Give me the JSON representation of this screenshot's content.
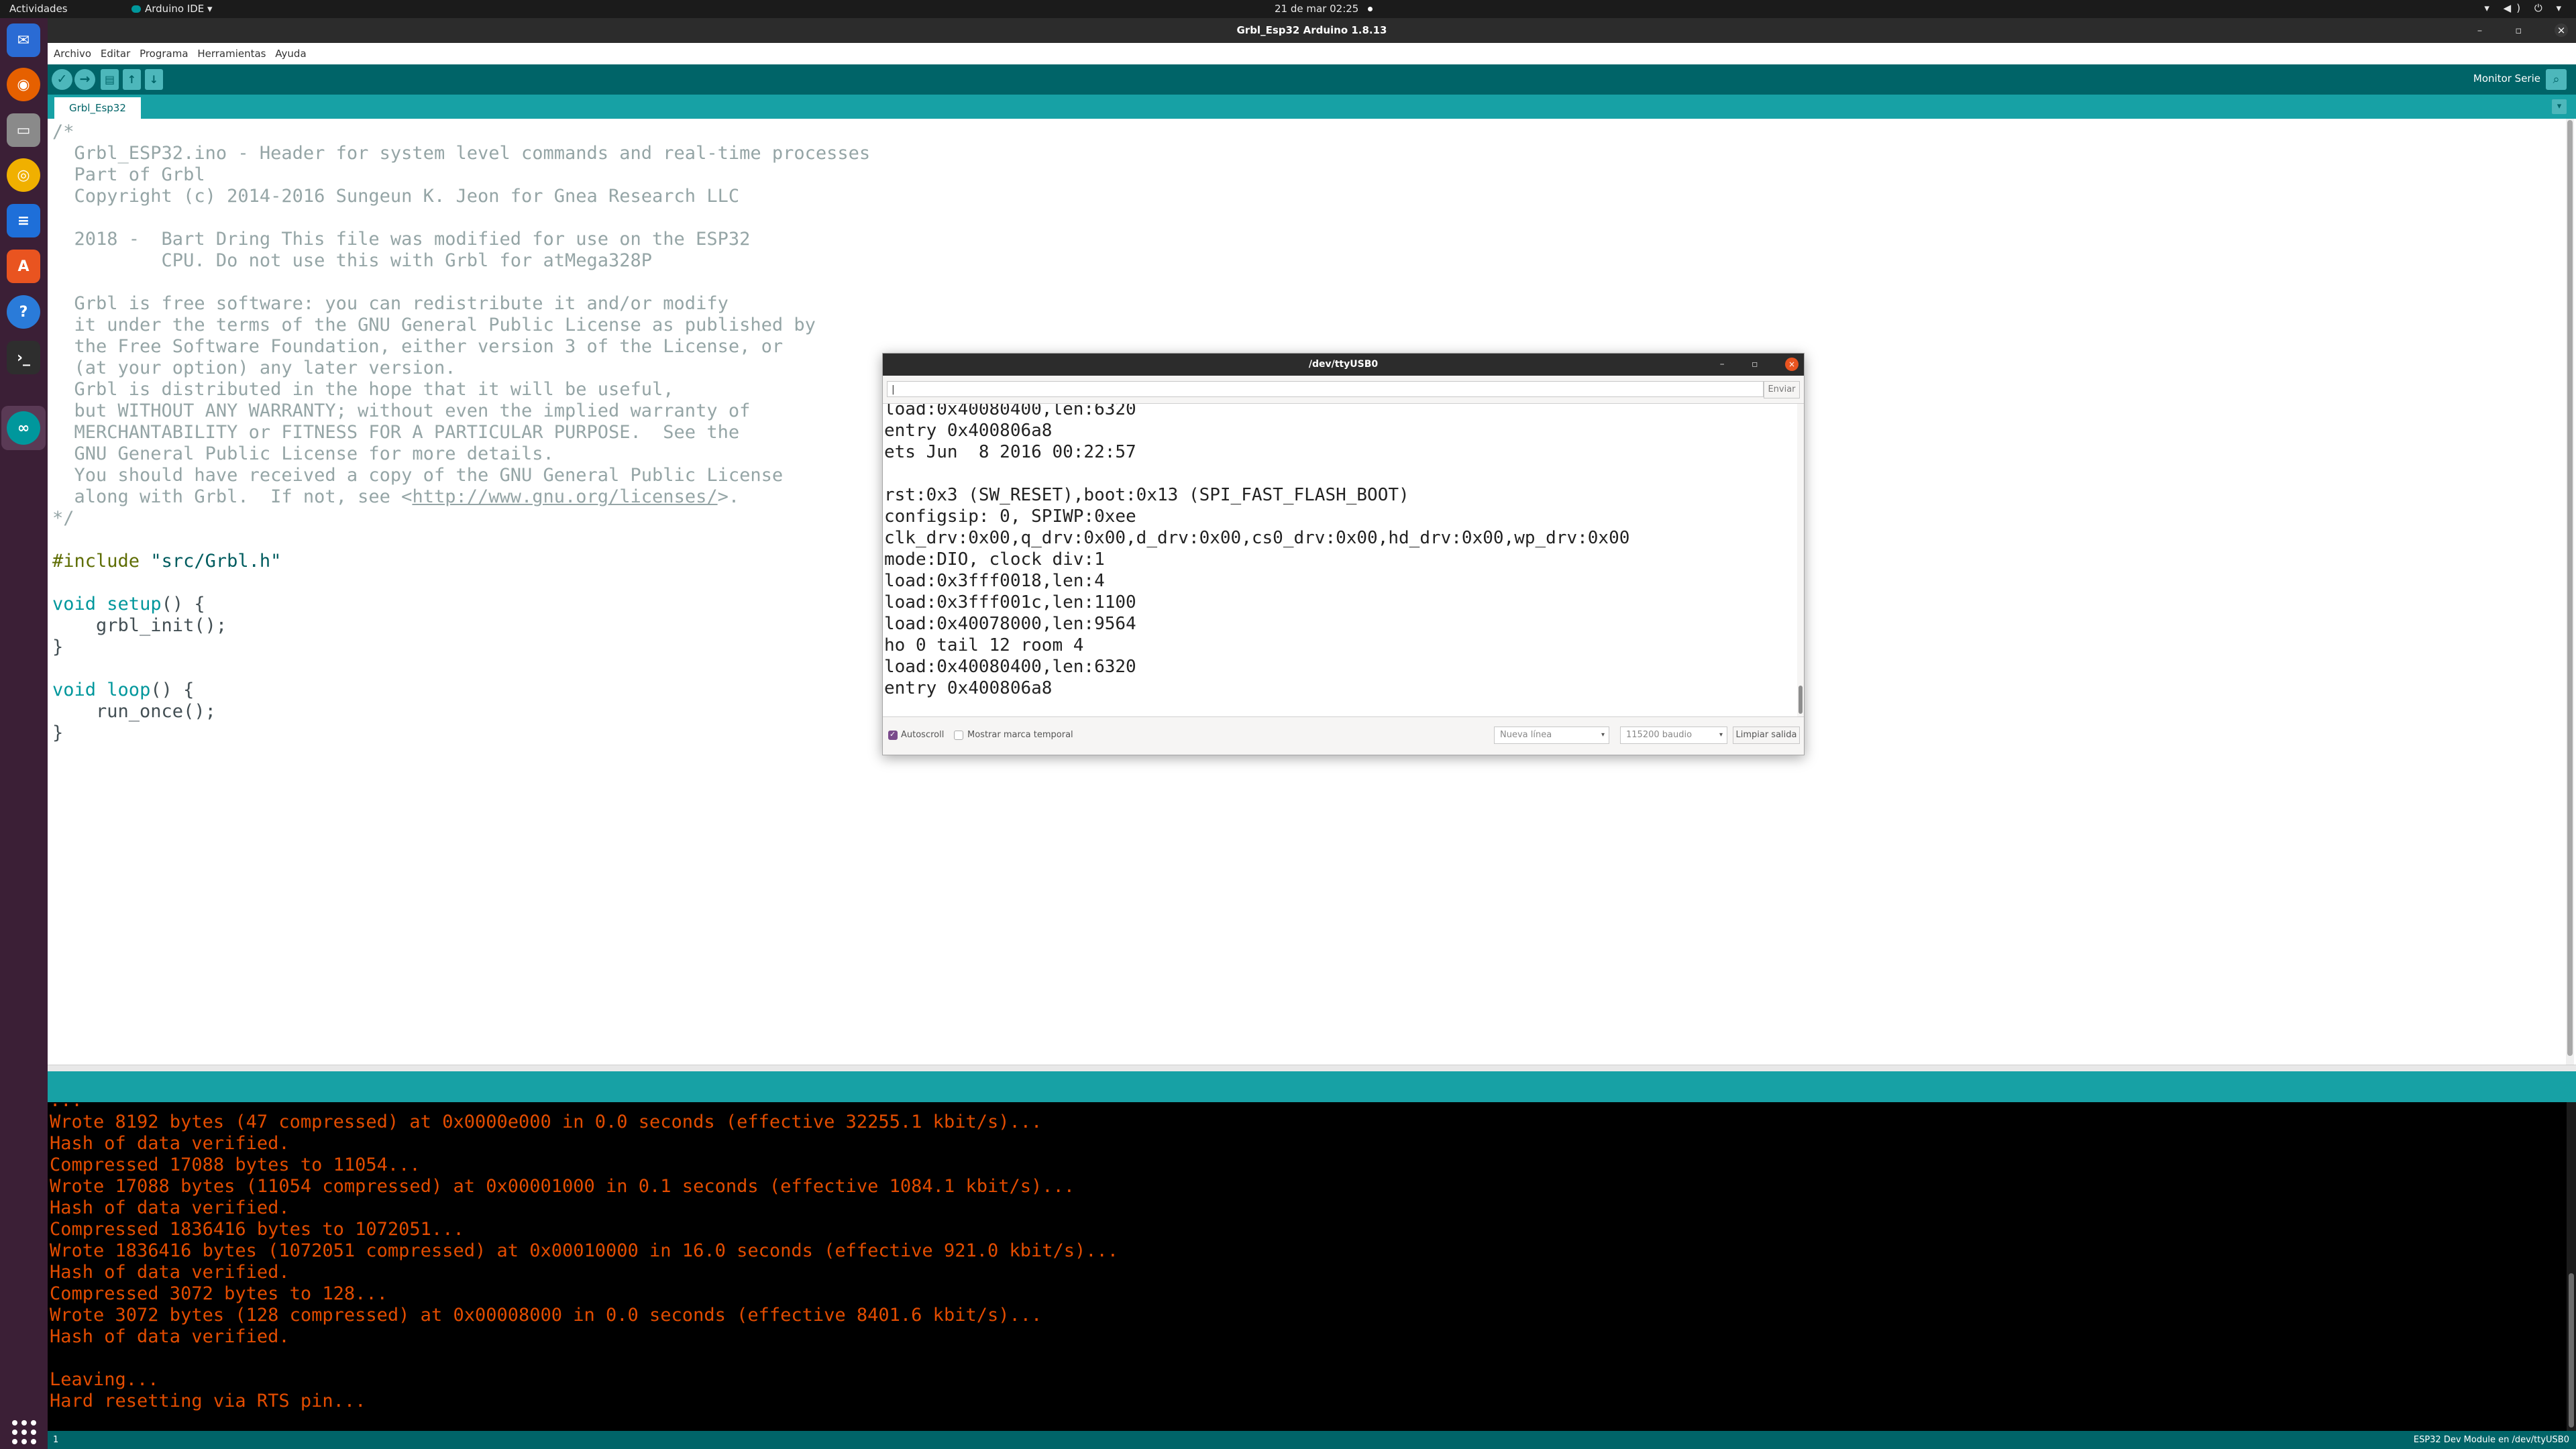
{
  "topbar": {
    "activities": "Actividades",
    "app_menu": "Arduino IDE ▾",
    "clock": "21 de mar  02:25",
    "tray": "▾ ◀) ⏻ ▾"
  },
  "dock": {
    "apps": [
      "thunderbird-icon",
      "firefox-icon",
      "files-icon",
      "rhythmbox-icon",
      "writer-icon",
      "software-icon",
      "help-icon",
      "terminal-icon",
      "arduino-icon"
    ]
  },
  "window": {
    "title": "Grbl_Esp32 Arduino 1.8.13",
    "controls": "–  ▫ "
  },
  "menu": [
    "Archivo",
    "Editar",
    "Programa",
    "Herramientas",
    "Ayuda"
  ],
  "toolbar": {
    "verify": "✓",
    "upload": "→",
    "new": "▤",
    "open": "↑",
    "save": "↓",
    "serial_monitor_label": "Monitor Serie",
    "serial_monitor_icon": "⌕"
  },
  "tab": {
    "name": "Grbl_Esp32",
    "menu_icon": "▾"
  },
  "code": [
    [
      {
        "t": "/*",
        "c": "c-com"
      }
    ],
    [
      {
        "t": "  Grbl_ESP32.ino - Header for system level commands and real-time processes",
        "c": "c-com"
      }
    ],
    [
      {
        "t": "  Part of Grbl",
        "c": "c-com"
      }
    ],
    [
      {
        "t": "  Copyright (c) 2014-2016 Sungeun K. Jeon for Gnea Research LLC",
        "c": "c-com"
      }
    ],
    [
      {
        "t": "",
        "c": "c-com"
      }
    ],
    [
      {
        "t": "  2018 -  Bart Dring This file was modified for use on the ESP32",
        "c": "c-com"
      }
    ],
    [
      {
        "t": "          CPU. Do not use this with Grbl for atMega328P",
        "c": "c-com"
      }
    ],
    [
      {
        "t": "",
        "c": "c-com"
      }
    ],
    [
      {
        "t": "  Grbl is free software: you can redistribute it and/or modify",
        "c": "c-com"
      }
    ],
    [
      {
        "t": "  it under the terms of the GNU General Public License as published by",
        "c": "c-com"
      }
    ],
    [
      {
        "t": "  the Free Software Foundation, either version 3 of the License, or",
        "c": "c-com"
      }
    ],
    [
      {
        "t": "  (at your option) any later version.",
        "c": "c-com"
      }
    ],
    [
      {
        "t": "  Grbl is distributed in the hope that it will be useful,",
        "c": "c-com"
      }
    ],
    [
      {
        "t": "  but WITHOUT ANY WARRANTY; without even the implied warranty of",
        "c": "c-com"
      }
    ],
    [
      {
        "t": "  MERCHANTABILITY or FITNESS FOR A PARTICULAR PURPOSE.  See the",
        "c": "c-com"
      }
    ],
    [
      {
        "t": "  GNU General Public License for more details.",
        "c": "c-com"
      }
    ],
    [
      {
        "t": "  You should have received a copy of the GNU General Public License",
        "c": "c-com"
      }
    ],
    [
      {
        "t": "  along with Grbl.  If not, see <",
        "c": "c-com"
      },
      {
        "t": "http://www.gnu.org/licenses/",
        "c": "c-link"
      },
      {
        "t": ">.",
        "c": "c-com"
      }
    ],
    [
      {
        "t": "*/",
        "c": "c-com"
      }
    ],
    [
      {
        "t": "",
        "c": "c-plain"
      }
    ],
    [
      {
        "t": "#include ",
        "c": "c-pp"
      },
      {
        "t": "\"src/Grbl.h\"",
        "c": "c-str"
      }
    ],
    [
      {
        "t": "",
        "c": "c-plain"
      }
    ],
    [
      {
        "t": "void",
        "c": "c-kw"
      },
      {
        "t": " ",
        "c": "c-plain"
      },
      {
        "t": "setup",
        "c": "c-kw"
      },
      {
        "t": "() {",
        "c": "c-plain"
      }
    ],
    [
      {
        "t": "    grbl_init();",
        "c": "c-plain"
      }
    ],
    [
      {
        "t": "}",
        "c": "c-plain"
      }
    ],
    [
      {
        "t": "",
        "c": "c-plain"
      }
    ],
    [
      {
        "t": "void",
        "c": "c-kw"
      },
      {
        "t": " ",
        "c": "c-plain"
      },
      {
        "t": "loop",
        "c": "c-kw"
      },
      {
        "t": "() {",
        "c": "c-plain"
      }
    ],
    [
      {
        "t": "    run_once();",
        "c": "c-plain"
      }
    ],
    [
      {
        "t": "}",
        "c": "c-plain"
      }
    ]
  ],
  "console": [
    "...",
    "Wrote 8192 bytes (47 compressed) at 0x0000e000 in 0.0 seconds (effective 32255.1 kbit/s)...",
    "Hash of data verified.",
    "Compressed 17088 bytes to 11054...",
    "Wrote 17088 bytes (11054 compressed) at 0x00001000 in 0.1 seconds (effective 1084.1 kbit/s)...",
    "Hash of data verified.",
    "Compressed 1836416 bytes to 1072051...",
    "Wrote 1836416 bytes (1072051 compressed) at 0x00010000 in 16.0 seconds (effective 921.0 kbit/s)...",
    "Hash of data verified.",
    "Compressed 3072 bytes to 128...",
    "Wrote 3072 bytes (128 compressed) at 0x00008000 in 0.0 seconds (effective 8401.6 kbit/s)...",
    "Hash of data verified.",
    "",
    "Leaving...",
    "Hard resetting via RTS pin..."
  ],
  "statusbar": {
    "line": "1",
    "board": "ESP32 Dev Module en /dev/ttyUSB0"
  },
  "serial": {
    "title": "/dev/ttyUSB0",
    "controls": "–  ▫ ",
    "close": "×",
    "input_value": "|",
    "send": "Enviar",
    "lines": [
      "load:0x40080400,len:6320",
      "entry 0x400806a8",
      "ets Jun  8 2016 00:22:57",
      "",
      "rst:0x3 (SW_RESET),boot:0x13 (SPI_FAST_FLASH_BOOT)",
      "configsip: 0, SPIWP:0xee",
      "clk_drv:0x00,q_drv:0x00,d_drv:0x00,cs0_drv:0x00,hd_drv:0x00,wp_drv:0x00",
      "mode:DIO, clock div:1",
      "load:0x3fff0018,len:4",
      "load:0x3fff001c,len:1100",
      "load:0x40078000,len:9564",
      "ho 0 tail 12 room 4",
      "load:0x40080400,len:6320",
      "entry 0x400806a8"
    ],
    "autoscroll": "Autoscroll",
    "timestamp": "Mostrar marca temporal",
    "line_ending": "Nueva línea",
    "baud": "115200 baudio",
    "clear": "Limpiar salida",
    "arrow": "▾"
  }
}
